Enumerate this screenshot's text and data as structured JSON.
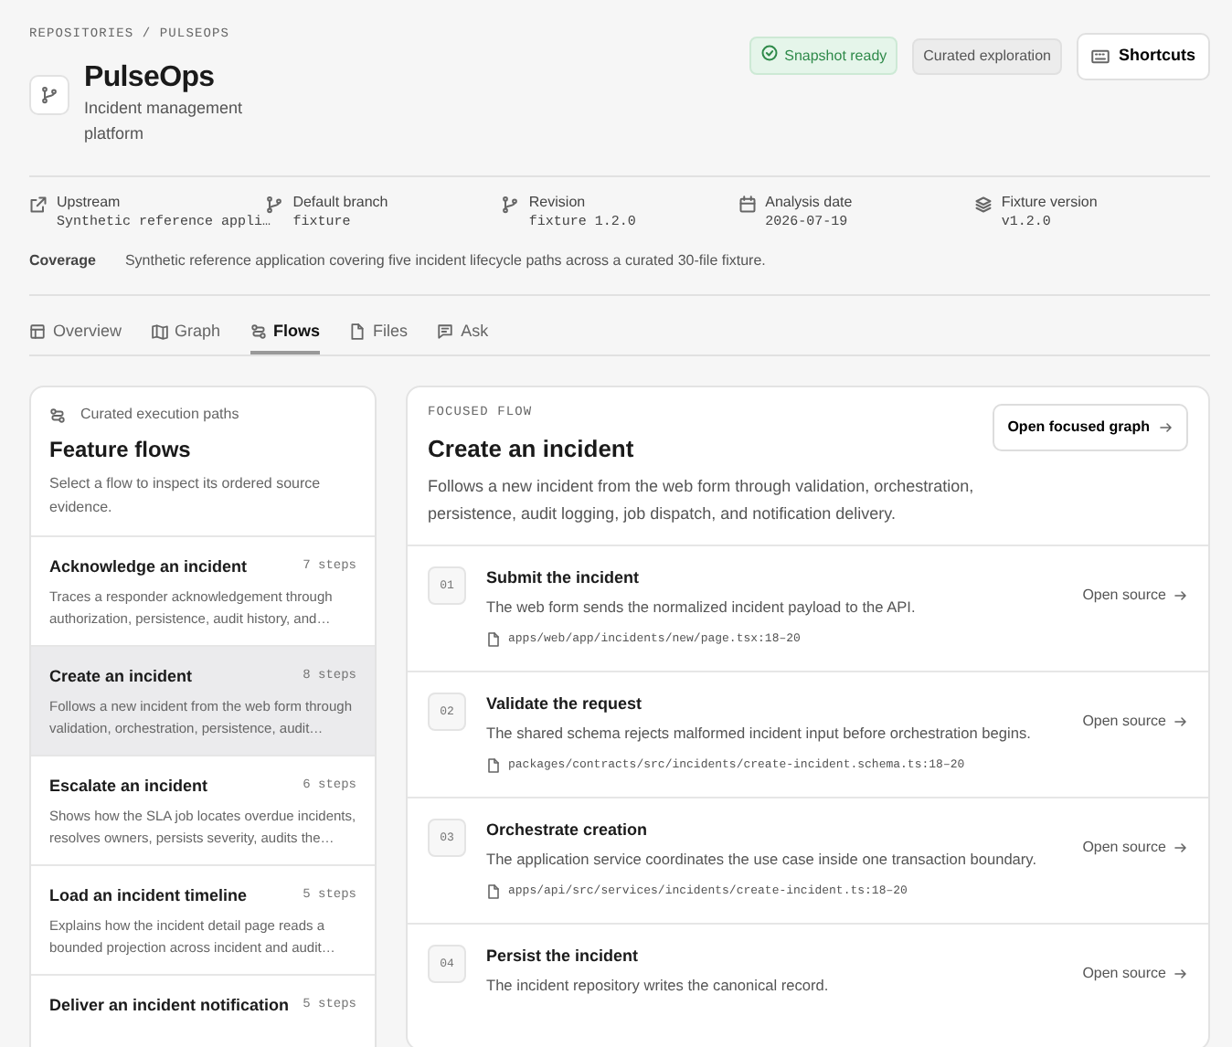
{
  "breadcrumb": "REPOSITORIES / PULSEOPS",
  "repo": {
    "name": "PulseOps",
    "description": "Incident management platform"
  },
  "badges": [
    {
      "label": "Snapshot ready",
      "kind": "success"
    },
    {
      "label": "Curated exploration",
      "kind": "neutral"
    }
  ],
  "shortcuts_button": "Shortcuts",
  "meta": [
    {
      "kind": "link",
      "label": "Upstream",
      "value": "Synthetic reference appli…"
    },
    {
      "kind": "branch",
      "label": "Default branch",
      "value": "fixture"
    },
    {
      "kind": "branch",
      "label": "Revision",
      "value": "fixture 1.2.0"
    },
    {
      "kind": "calendar",
      "label": "Analysis date",
      "value": "2026-07-19"
    },
    {
      "kind": "layers",
      "label": "Fixture version",
      "value": "v1.2.0"
    }
  ],
  "coverage": {
    "label": "Coverage",
    "text": "Synthetic reference application covering five incident lifecycle paths across a curated 30-file fixture."
  },
  "tabs": [
    {
      "label": "Overview",
      "kind": "layout",
      "selected": false
    },
    {
      "label": "Graph",
      "kind": "map",
      "selected": false
    },
    {
      "label": "Flows",
      "kind": "flows",
      "selected": true
    },
    {
      "label": "Files",
      "kind": "file",
      "selected": false
    },
    {
      "label": "Ask",
      "kind": "chat",
      "selected": false
    }
  ],
  "flows_panel": {
    "eyebrow": "Curated execution paths",
    "title": "Feature flows",
    "description": "Select a flow to inspect its ordered source evidence.",
    "items": [
      {
        "title": "Acknowledge an incident",
        "steps": "7 steps",
        "summary": "Traces a responder acknowledgement through authorization, persistence, audit history, and…",
        "selected": false
      },
      {
        "title": "Create an incident",
        "steps": "8 steps",
        "summary": "Follows a new incident from the web form through validation, orchestration, persistence, audit…",
        "selected": true
      },
      {
        "title": "Escalate an incident",
        "steps": "6 steps",
        "summary": "Shows how the SLA job locates overdue incidents, resolves owners, persists severity, audits the…",
        "selected": false
      },
      {
        "title": "Load an incident timeline",
        "steps": "5 steps",
        "summary": "Explains how the incident detail page reads a bounded projection across incident and audit…",
        "selected": false
      },
      {
        "title": "Deliver an incident notification",
        "steps": "5 steps",
        "selected": false
      }
    ]
  },
  "focused_flow": {
    "eyebrow": "FOCUSED FLOW",
    "title": "Create an incident",
    "button": "Open focused graph",
    "description": "Follows a new incident from the web form through validation, orchestration, persistence, audit logging, job dispatch, and notification delivery.",
    "steps": [
      {
        "number": "01",
        "title": "Submit the incident",
        "description": "The web form sends the normalized incident payload to the API.",
        "path": "apps/web/app/incidents/new/page.tsx:18–20",
        "link": "Open source"
      },
      {
        "number": "02",
        "title": "Validate the request",
        "description": "The shared schema rejects malformed incident input before orchestration begins.",
        "path": "packages/contracts/src/incidents/create-incident.schema.ts:18–20",
        "link": "Open source"
      },
      {
        "number": "03",
        "title": "Orchestrate creation",
        "description": "The application service coordinates the use case inside one transaction boundary.",
        "path": "apps/api/src/services/incidents/create-incident.ts:18–20",
        "link": "Open source"
      },
      {
        "number": "04",
        "title": "Persist the incident",
        "description": "The incident repository writes the canonical record.",
        "link": "Open source"
      }
    ]
  }
}
